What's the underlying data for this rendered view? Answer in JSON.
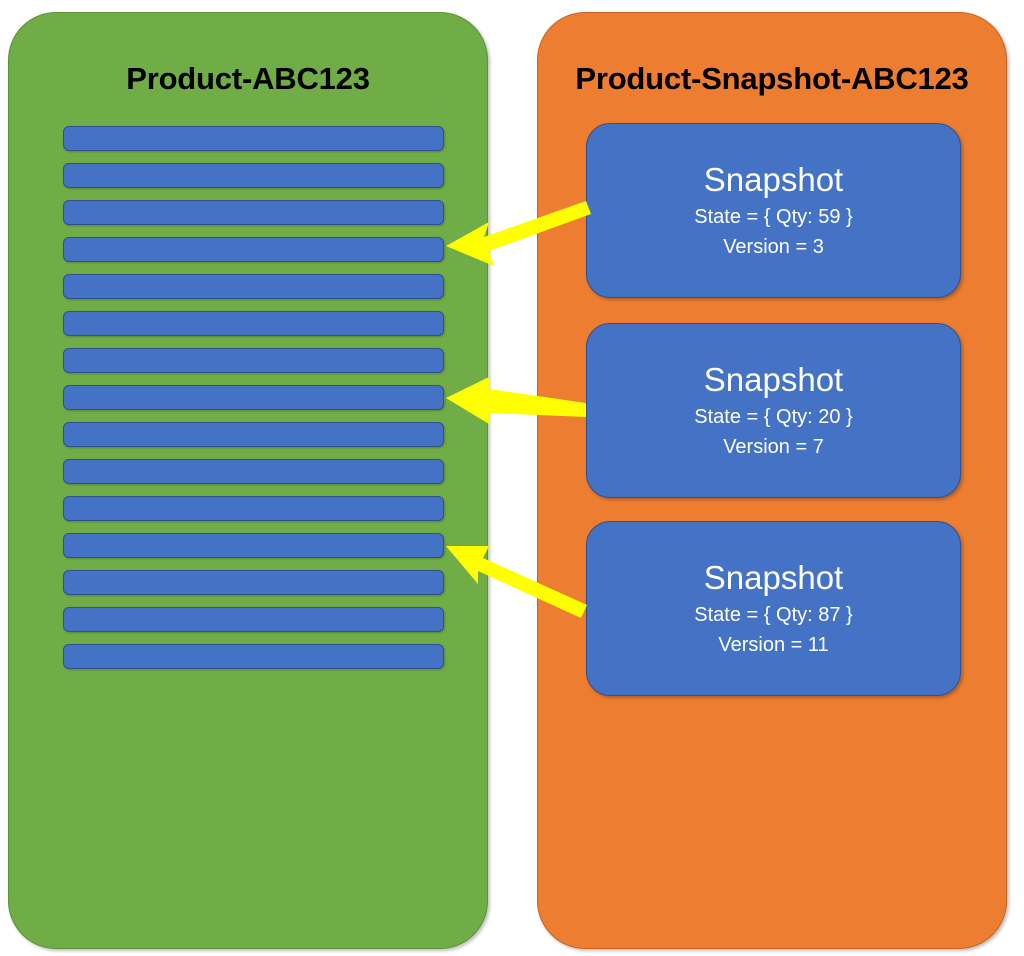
{
  "diagram": {
    "type": "event-sourcing-snapshot-diagram",
    "background_color": "#FFFFFF",
    "panels": [
      {
        "id": "aggregate-stream",
        "title": "Product-ABC123",
        "color": "#70AD47",
        "title_color": "#000000",
        "event_count": 15,
        "event_color": "#4472C4"
      },
      {
        "id": "snapshot-stream",
        "title": "Product-Snapshot-ABC123",
        "color": "#ED7D31",
        "title_color": "#000000",
        "card_color": "#4472C4"
      }
    ],
    "events": [
      {
        "index": 1
      },
      {
        "index": 2
      },
      {
        "index": 3
      },
      {
        "index": 4
      },
      {
        "index": 5
      },
      {
        "index": 6
      },
      {
        "index": 7
      },
      {
        "index": 8
      },
      {
        "index": 9
      },
      {
        "index": 10
      },
      {
        "index": 11
      },
      {
        "index": 12
      },
      {
        "index": 13
      },
      {
        "index": 14
      },
      {
        "index": 15
      }
    ],
    "snapshots": [
      {
        "title": "Snapshot",
        "state": "State = { Qty: 59 }",
        "version": "Version = 3",
        "qty": 59,
        "version_number": 3,
        "points_to_event_index": 4
      },
      {
        "title": "Snapshot",
        "state": "State = { Qty: 20 }",
        "version": "Version = 7",
        "qty": 20,
        "version_number": 7,
        "points_to_event_index": 8
      },
      {
        "title": "Snapshot",
        "state": "State = { Qty: 87 }",
        "version": "Version = 11",
        "qty": 87,
        "version_number": 11,
        "points_to_event_index": 12
      }
    ],
    "arrows": {
      "color": "#FFFF00",
      "count": 3,
      "direction": "right-to-left"
    }
  }
}
